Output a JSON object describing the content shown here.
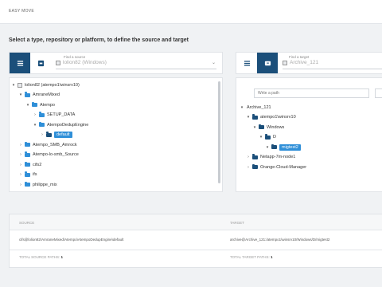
{
  "header": {
    "title": "EASY MOVE"
  },
  "instruction": "Select a type, repository or platform, to define the source and target",
  "source": {
    "find_label": "Find a source",
    "selected": "lolion82 (Windows)"
  },
  "target": {
    "find_label": "Find a target",
    "selected": "Archive_121",
    "path_placeholder": "Write a path"
  },
  "source_tree": [
    {
      "label": "lolion82 (atempo1\\winsrv10)",
      "level": 0,
      "toggle": "▾",
      "kind": "server"
    },
    {
      "label": "AmraneMixed",
      "level": 1,
      "toggle": "▾",
      "kind": "folder"
    },
    {
      "label": "Atempo",
      "level": 2,
      "toggle": "▾",
      "kind": "folder"
    },
    {
      "label": "SETUP_DATA",
      "level": 3,
      "toggle": "›",
      "kind": "folder"
    },
    {
      "label": "AtempoDedupEngine",
      "level": 3,
      "toggle": "▾",
      "kind": "folder"
    },
    {
      "label": "default",
      "level": 4,
      "toggle": "›",
      "kind": "folder-dark",
      "highlight": true
    },
    {
      "label": "Atempo_SMB_Amrock",
      "level": 1,
      "toggle": "›",
      "kind": "folder"
    },
    {
      "label": "Atempo-lo-smb_Source",
      "level": 1,
      "toggle": "›",
      "kind": "folder"
    },
    {
      "label": "cifs2",
      "level": 1,
      "toggle": "›",
      "kind": "folder"
    },
    {
      "label": "ifs",
      "level": 1,
      "toggle": "›",
      "kind": "folder"
    },
    {
      "label": "philippe_mix",
      "level": 1,
      "toggle": "›",
      "kind": "folder"
    }
  ],
  "target_tree": [
    {
      "label": "Archive_121",
      "level": 0,
      "toggle": "▾",
      "kind": "none"
    },
    {
      "label": "atempo1\\winsrv10",
      "level": 1,
      "toggle": "▾",
      "kind": "folder-dark"
    },
    {
      "label": "Windows",
      "level": 2,
      "toggle": "▾",
      "kind": "folder-dark"
    },
    {
      "label": "D",
      "level": 3,
      "toggle": "▾",
      "kind": "folder-dark"
    },
    {
      "label": "migtest2",
      "level": 4,
      "toggle": "▾",
      "kind": "folder-dark",
      "highlight": true
    },
    {
      "label": "Netapp-7m-node1",
      "level": 1,
      "toggle": "›",
      "kind": "folder-dark"
    },
    {
      "label": "Orange-Cloud-Manager",
      "level": 1,
      "toggle": "›",
      "kind": "folder-dark"
    }
  ],
  "summary": {
    "source_header": "SOURCE",
    "target_header": "TARGET",
    "source_path": "cifs@lolion82\\AmraneMixed\\Atempo\\AtempoDedupEngine\\default",
    "target_path": "archive@Archive_121:/atempo1\\winsrv10/Windows/D/migtest2",
    "total_source_label": "TOTAL SOURCE PATHS:",
    "total_source_value": "1",
    "total_target_label": "TOTAL TARGET PATHS:",
    "total_target_value": "1"
  }
}
